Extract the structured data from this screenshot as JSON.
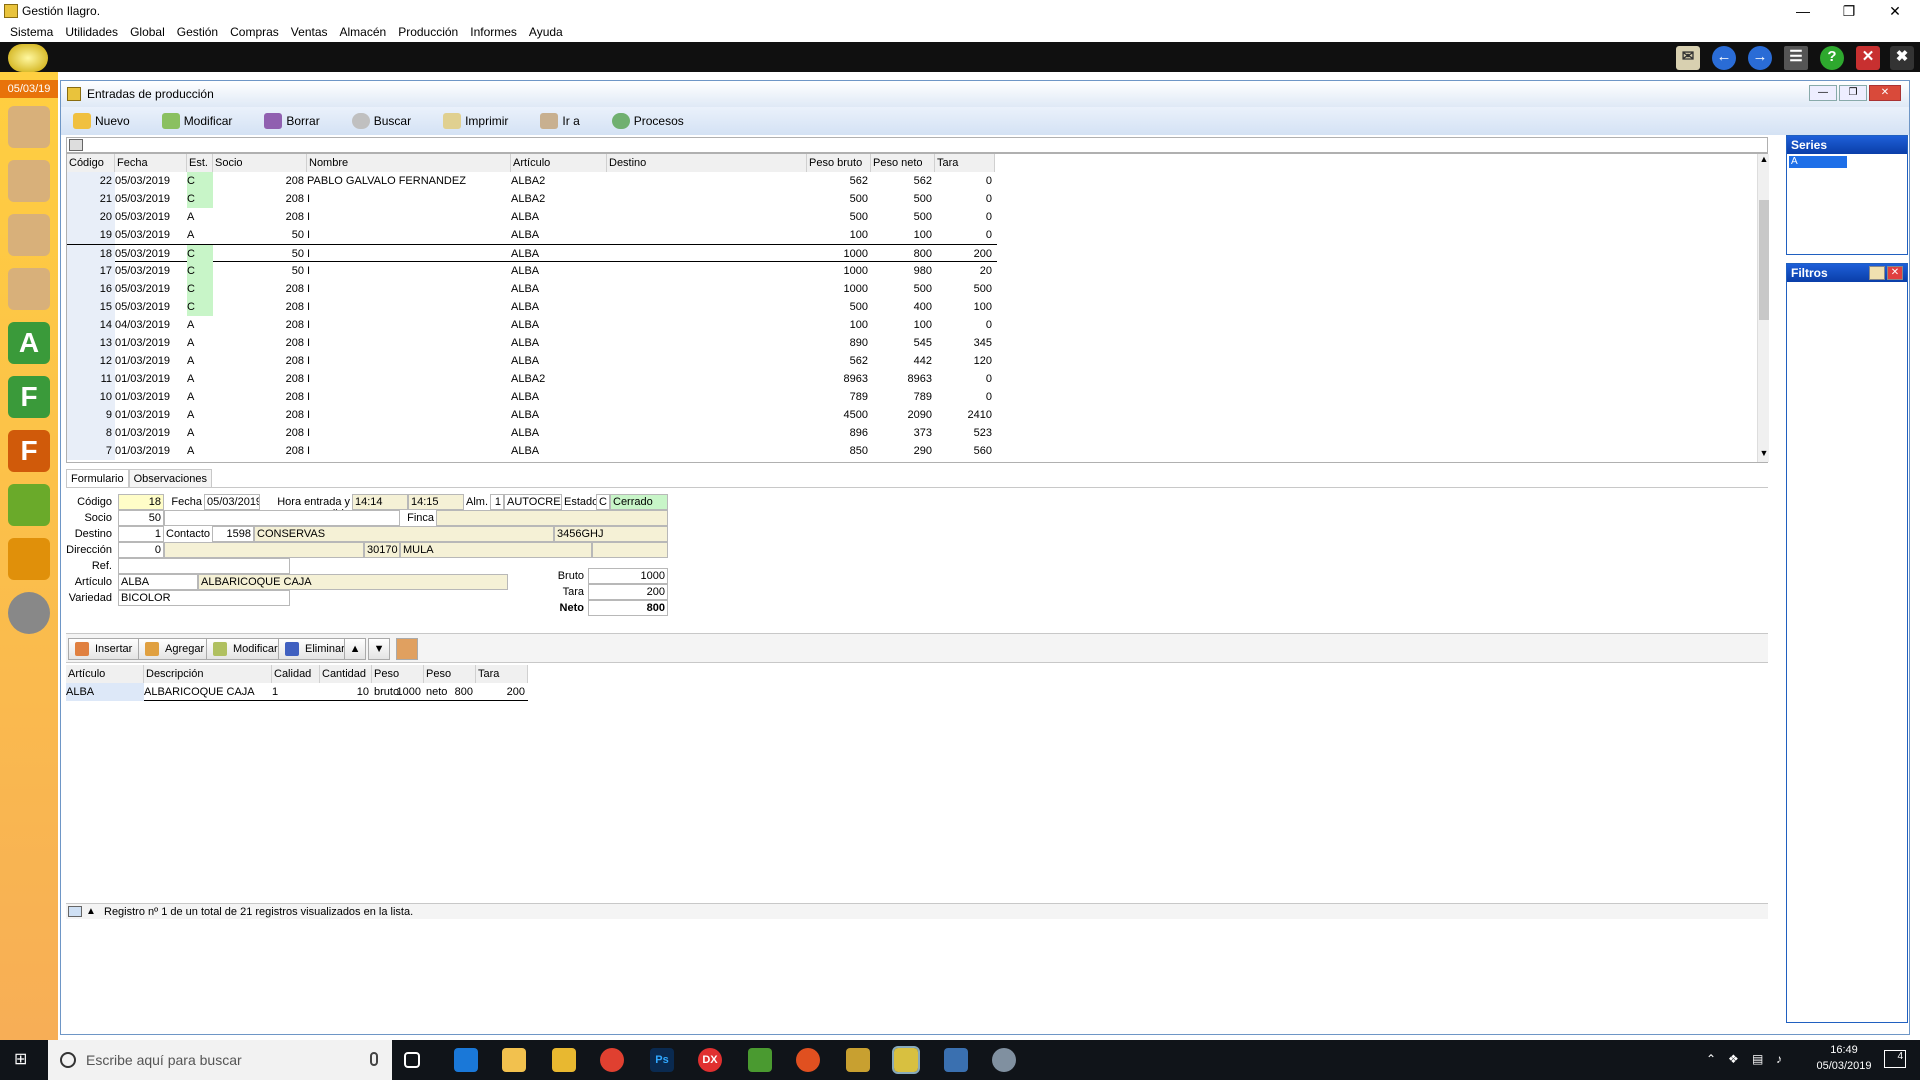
{
  "app": {
    "title": "Gestión Ilagro.",
    "date_badge": "05/03/19"
  },
  "menu": [
    "Sistema",
    "Utilidades",
    "Global",
    "Gestión",
    "Compras",
    "Ventas",
    "Almacén",
    "Producción",
    "Informes",
    "Ayuda"
  ],
  "inner": {
    "title": "Entradas de producción"
  },
  "toolbar": [
    "Nuevo",
    "Modificar",
    "Borrar",
    "Buscar",
    "Imprimir",
    "Ir a",
    "Procesos"
  ],
  "grid": {
    "columns": [
      "Código",
      "Fecha",
      "Est.",
      "Socio",
      "Nombre",
      "Artículo",
      "Destino",
      "Peso bruto",
      "Peso neto",
      "Tara"
    ],
    "rows": [
      [
        "22",
        "05/03/2019",
        "C",
        "208",
        "PABLO GALVALO FERNANDEZ",
        "ALBA2",
        "",
        "562",
        "562",
        "0"
      ],
      [
        "21",
        "05/03/2019",
        "C",
        "208",
        "I",
        "ALBA2",
        "",
        "500",
        "500",
        "0"
      ],
      [
        "20",
        "05/03/2019",
        "A",
        "208",
        "I",
        "ALBA",
        "",
        "500",
        "500",
        "0"
      ],
      [
        "19",
        "05/03/2019",
        "A",
        "50",
        "I",
        "ALBA",
        "",
        "100",
        "100",
        "0"
      ],
      [
        "18",
        "05/03/2019",
        "C",
        "50",
        "I",
        "ALBA",
        "",
        "1000",
        "800",
        "200"
      ],
      [
        "17",
        "05/03/2019",
        "C",
        "50",
        "I",
        "ALBA",
        "",
        "1000",
        "980",
        "20"
      ],
      [
        "16",
        "05/03/2019",
        "C",
        "208",
        "I",
        "ALBA",
        "",
        "1000",
        "500",
        "500"
      ],
      [
        "15",
        "05/03/2019",
        "C",
        "208",
        "I",
        "ALBA",
        "",
        "500",
        "400",
        "100"
      ],
      [
        "14",
        "04/03/2019",
        "A",
        "208",
        "I",
        "ALBA",
        "",
        "100",
        "100",
        "0"
      ],
      [
        "13",
        "01/03/2019",
        "A",
        "208",
        "I",
        "ALBA",
        "",
        "890",
        "545",
        "345"
      ],
      [
        "12",
        "01/03/2019",
        "A",
        "208",
        "I",
        "ALBA",
        "",
        "562",
        "442",
        "120"
      ],
      [
        "11",
        "01/03/2019",
        "A",
        "208",
        "I",
        "ALBA2",
        "",
        "8963",
        "8963",
        "0"
      ],
      [
        "10",
        "01/03/2019",
        "A",
        "208",
        "I",
        "ALBA",
        "",
        "789",
        "789",
        "0"
      ],
      [
        "9",
        "01/03/2019",
        "A",
        "208",
        "I",
        "ALBA",
        "",
        "4500",
        "2090",
        "2410"
      ],
      [
        "8",
        "01/03/2019",
        "A",
        "208",
        "I",
        "ALBA",
        "",
        "896",
        "373",
        "523"
      ],
      [
        "7",
        "01/03/2019",
        "A",
        "208",
        "I",
        "ALBA",
        "",
        "850",
        "290",
        "560"
      ]
    ]
  },
  "series": {
    "title": "Series",
    "items": [
      "A"
    ]
  },
  "filtros": {
    "title": "Filtros"
  },
  "tabs": [
    "Formulario",
    "Observaciones"
  ],
  "form": {
    "codigo_label": "Código",
    "codigo": "18",
    "fecha_label": "Fecha",
    "fecha": "05/03/2019",
    "hora_label": "Hora entrada y salida",
    "hora_entrada": "14:14",
    "hora_salida": "14:15",
    "alm_label": "Alm.",
    "alm_num": "1",
    "alm_name": "AUTOCREAD",
    "estado_label": "Estado",
    "estado_code": "C",
    "estado": "Cerrado",
    "socio_label": "Socio",
    "socio": "50",
    "finca_label": "Finca",
    "destino_label": "Destino",
    "destino": "1",
    "contacto_label": "Contacto",
    "contacto_num": "1598",
    "contacto_name": "CONSERVAS",
    "contacto_code": "3456GHJ",
    "direccion_label": "Dirección",
    "direccion": "0",
    "cp": "30170",
    "poblacion": "MULA",
    "ref_label": "Ref.",
    "articulo_label": "Artículo",
    "articulo": "ALBA",
    "articulo_desc": "ALBARICOQUE CAJA",
    "variedad_label": "Variedad",
    "variedad": "BICOLOR",
    "bruto_label": "Bruto",
    "bruto": "1000",
    "tara_label": "Tara",
    "tara": "200",
    "neto_label": "Neto",
    "neto": "800"
  },
  "lower_toolbar": [
    "Insertar",
    "Agregar",
    "Modificar",
    "Eliminar"
  ],
  "detail": {
    "columns": [
      "Artículo",
      "Descripción",
      "Calidad",
      "Cantidad",
      "Peso bruto",
      "Peso neto",
      "Tara"
    ],
    "rows": [
      [
        "ALBA",
        "ALBARICOQUE CAJA",
        "1",
        "10",
        "1000",
        "800",
        "200"
      ]
    ]
  },
  "status": "Registro nº 1 de un total de 21 registros visualizados en la lista.",
  "taskbar": {
    "search_placeholder": "Escribe aquí para buscar",
    "time": "16:49",
    "date": "05/03/2019",
    "notif_count": "4"
  },
  "colors": {
    "accent": "#1e5fd8",
    "yellow_field": "#fffdc8",
    "green_field": "#c8f5c8"
  }
}
